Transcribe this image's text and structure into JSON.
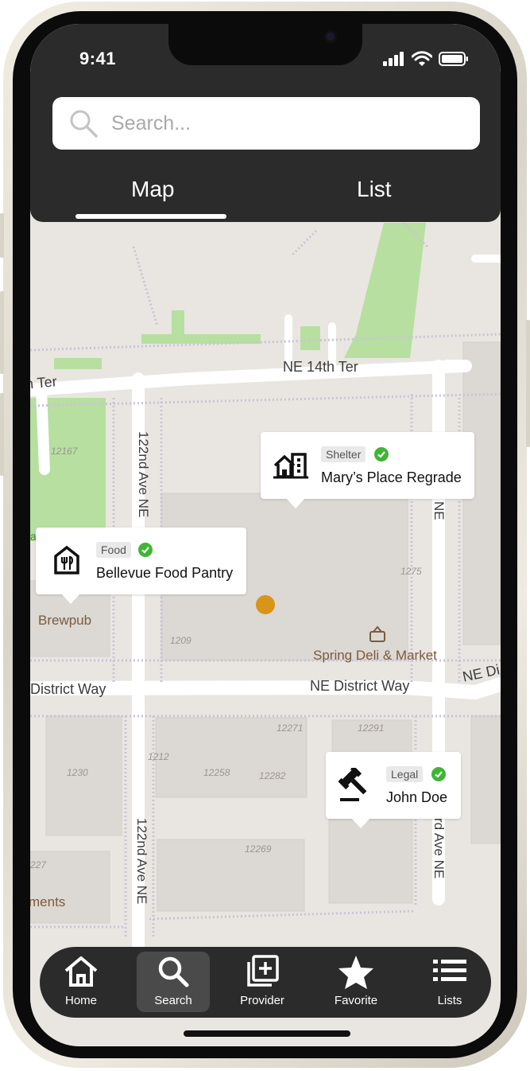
{
  "status_bar": {
    "time": "9:41"
  },
  "search": {
    "placeholder": "Search..."
  },
  "tabs": {
    "map": "Map",
    "list": "List",
    "active": "Map"
  },
  "map": {
    "street_labels": {
      "ne_14th_ter": "NE 14th Ter",
      "ter_left": "h Ter",
      "ave_122nd_upper": "122nd Ave NE",
      "ave_122nd_lower": "122nd Ave NE",
      "ne_right": "NE",
      "rd_ave_ne": "rd Ave NE",
      "district_way_left": "District Way",
      "ne_district_way": "NE District Way",
      "ne_di": "NE Di"
    },
    "poi_labels": {
      "brewpub": "Brewpub",
      "spring_deli": "Spring Deli & Market",
      "ments": "ments",
      "a": "a"
    },
    "building_numbers": [
      "12167",
      "1209",
      "1275",
      "12271",
      "12291",
      "1230",
      "1212",
      "12258",
      "12282",
      "12269",
      "227"
    ]
  },
  "pins": [
    {
      "type": "Shelter",
      "name": "Mary’s Place Regrade",
      "icon": "building-icon",
      "verified": true
    },
    {
      "type": "Food",
      "name": "Bellevue Food Pantry",
      "icon": "food-pantry-icon",
      "verified": true
    },
    {
      "type": "Legal",
      "name": "John Doe",
      "icon": "gavel-icon",
      "verified": true
    }
  ],
  "bottom_nav": {
    "items": [
      {
        "label": "Home",
        "icon": "home-icon"
      },
      {
        "label": "Search",
        "icon": "search-icon"
      },
      {
        "label": "Provider",
        "icon": "add-provider-icon"
      },
      {
        "label": "Favorite",
        "icon": "star-icon"
      },
      {
        "label": "Lists",
        "icon": "list-icon"
      }
    ],
    "active": "Search"
  },
  "colors": {
    "header_bg": "#2b2b2b",
    "map_bg": "#e9e6e1",
    "park": "#b6dfa0",
    "verified": "#3fb535",
    "location_dot": "#d9951a"
  }
}
